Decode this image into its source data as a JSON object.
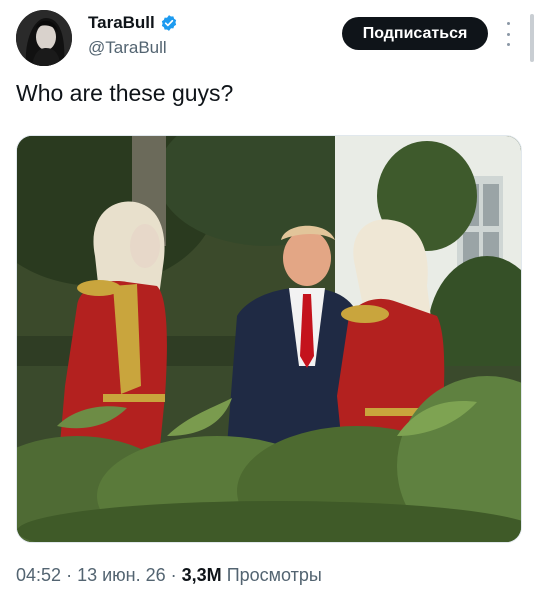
{
  "author": {
    "display_name": "TaraBull",
    "handle": "@TaraBull",
    "verified_icon": "verified-badge-icon",
    "avatar_icon": "avatar"
  },
  "actions": {
    "follow_label": "Подписаться",
    "more_icon": "more-options-icon"
  },
  "tweet": {
    "text": "Who are these guys?"
  },
  "meta": {
    "time": "04:52",
    "date": "13 июн. 26",
    "views_count": "3,3M",
    "views_label": "Просмотры",
    "separator": "·"
  },
  "colors": {
    "accent": "#1d9bf0",
    "button_bg": "#0f1419",
    "secondary_text": "#536471"
  }
}
